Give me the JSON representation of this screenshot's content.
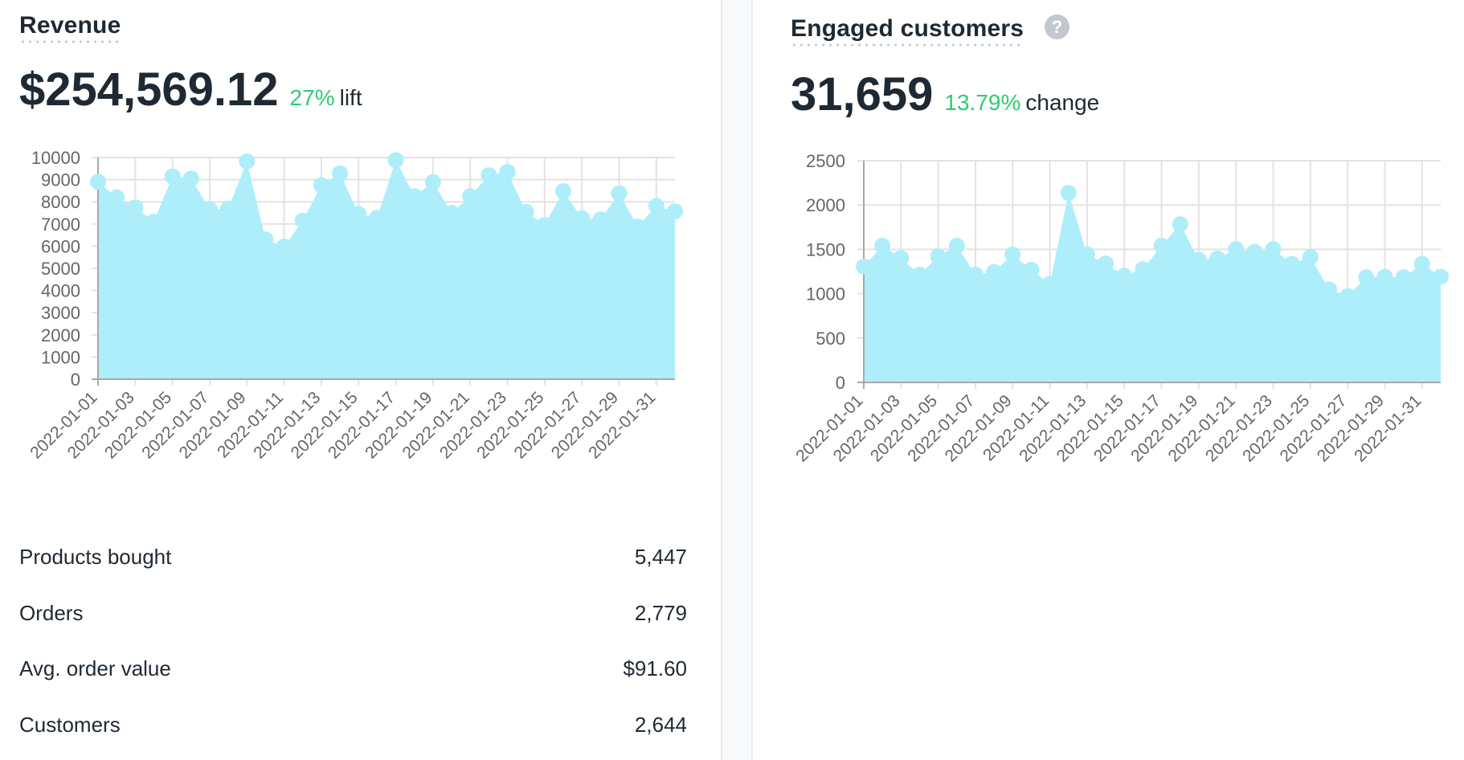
{
  "revenue": {
    "title": "Revenue",
    "value": "$254,569.12",
    "delta_pct": "27%",
    "delta_word": "lift"
  },
  "engaged": {
    "title": "Engaged customers",
    "help_icon": "question-circle-icon",
    "help_glyph": "?",
    "value": "31,659",
    "delta_pct": "13.79%",
    "delta_word": "change"
  },
  "stats": [
    {
      "label": "Products bought",
      "value": "5,447"
    },
    {
      "label": "Orders",
      "value": "2,779"
    },
    {
      "label": "Avg. order value",
      "value": "$91.60"
    },
    {
      "label": "Customers",
      "value": "2,644"
    }
  ],
  "colors": {
    "fill": "#aeeefb",
    "positive": "#2ecc71",
    "text": "#1f2933",
    "grid": "#e3e3e3",
    "axis": "#a8a8a8",
    "tick_text": "#666666"
  },
  "chart_data": [
    {
      "type": "area",
      "title": "Revenue",
      "xlabel": "",
      "ylabel": "",
      "ylim": [
        0,
        10000
      ],
      "yticks": [
        0,
        1000,
        2000,
        3000,
        4000,
        5000,
        6000,
        7000,
        8000,
        9000,
        10000
      ],
      "grid": true,
      "x": [
        "2022-01-01",
        "2022-01-02",
        "2022-01-03",
        "2022-01-04",
        "2022-01-05",
        "2022-01-06",
        "2022-01-07",
        "2022-01-08",
        "2022-01-09",
        "2022-01-10",
        "2022-01-11",
        "2022-01-12",
        "2022-01-13",
        "2022-01-14",
        "2022-01-15",
        "2022-01-16",
        "2022-01-17",
        "2022-01-18",
        "2022-01-19",
        "2022-01-20",
        "2022-01-21",
        "2022-01-22",
        "2022-01-23",
        "2022-01-24",
        "2022-01-25",
        "2022-01-26",
        "2022-01-27",
        "2022-01-28",
        "2022-01-29",
        "2022-01-30",
        "2022-01-31",
        "2022-02-01"
      ],
      "xtick_labels": [
        "2022-01-01",
        "2022-01-03",
        "2022-01-05",
        "2022-01-07",
        "2022-01-09",
        "2022-01-11",
        "2022-01-13",
        "2022-01-15",
        "2022-01-17",
        "2022-01-19",
        "2022-01-21",
        "2022-01-23",
        "2022-01-25",
        "2022-01-27",
        "2022-01-29",
        "2022-01-31"
      ],
      "values": [
        8900,
        8200,
        7750,
        7100,
        9150,
        9050,
        7650,
        7700,
        9820,
        6300,
        5980,
        7150,
        8750,
        9280,
        7450,
        7280,
        9880,
        8250,
        8890,
        7500,
        8250,
        9200,
        9350,
        7540,
        6960,
        8480,
        7260,
        7200,
        8380,
        6880,
        7810,
        7570
      ]
    },
    {
      "type": "area",
      "title": "Engaged customers",
      "xlabel": "",
      "ylabel": "",
      "ylim": [
        0,
        2500
      ],
      "yticks": [
        0,
        500,
        1000,
        1500,
        2000,
        2500
      ],
      "grid": true,
      "x": [
        "2022-01-01",
        "2022-01-02",
        "2022-01-03",
        "2022-01-04",
        "2022-01-05",
        "2022-01-06",
        "2022-01-07",
        "2022-01-08",
        "2022-01-09",
        "2022-01-10",
        "2022-01-11",
        "2022-01-12",
        "2022-01-13",
        "2022-01-14",
        "2022-01-15",
        "2022-01-16",
        "2022-01-17",
        "2022-01-18",
        "2022-01-19",
        "2022-01-20",
        "2022-01-21",
        "2022-01-22",
        "2022-01-23",
        "2022-01-24",
        "2022-01-25",
        "2022-01-26",
        "2022-01-27",
        "2022-01-28",
        "2022-01-29",
        "2022-01-30",
        "2022-01-31",
        "2022-02-01"
      ],
      "xtick_labels": [
        "2022-01-01",
        "2022-01-03",
        "2022-01-05",
        "2022-01-07",
        "2022-01-09",
        "2022-01-11",
        "2022-01-13",
        "2022-01-15",
        "2022-01-17",
        "2022-01-19",
        "2022-01-21",
        "2022-01-23",
        "2022-01-25",
        "2022-01-27",
        "2022-01-29",
        "2022-01-31"
      ],
      "values": [
        1306,
        1541,
        1402,
        1215,
        1421,
        1541,
        1215,
        1245,
        1442,
        1269,
        1110,
        2137,
        1442,
        1342,
        1203,
        1276,
        1541,
        1783,
        1381,
        1396,
        1502,
        1472,
        1502,
        1336,
        1412,
        1049,
        973,
        1185,
        1191,
        1185,
        1336,
        1191
      ]
    }
  ]
}
